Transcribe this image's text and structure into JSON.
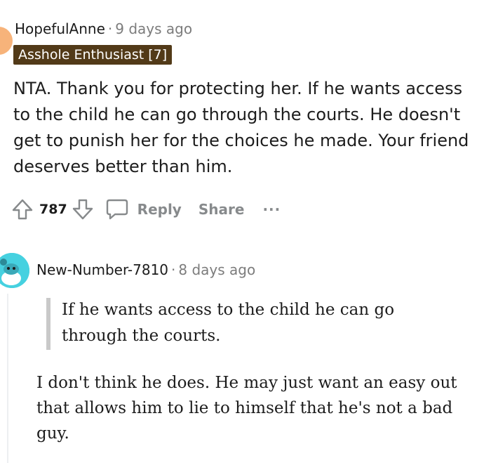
{
  "comment1": {
    "author": "HopefulAnne",
    "separator": "·",
    "time": "9 days ago",
    "flair": "Asshole Enthusiast [7]",
    "body": "NTA. Thank you for protecting her. If he wants access to the child he can go through the courts. He doesn't get to punish her for the choices he made. Your friend deserves better than him.",
    "votes": "787",
    "reply_label": "Reply",
    "share_label": "Share",
    "more_label": "···",
    "avatar_color": "#f7b37a",
    "flair_color": "#523a18"
  },
  "comment2": {
    "author": "New-Number-7810",
    "separator": "·",
    "time": "8 days ago",
    "quote": "If he wants access to the child he can go through the courts.",
    "body": "I don't think he does. He may just want an easy out that allows him to lie to himself that he's not a bad guy.",
    "avatar_color": "#46d1e0"
  }
}
